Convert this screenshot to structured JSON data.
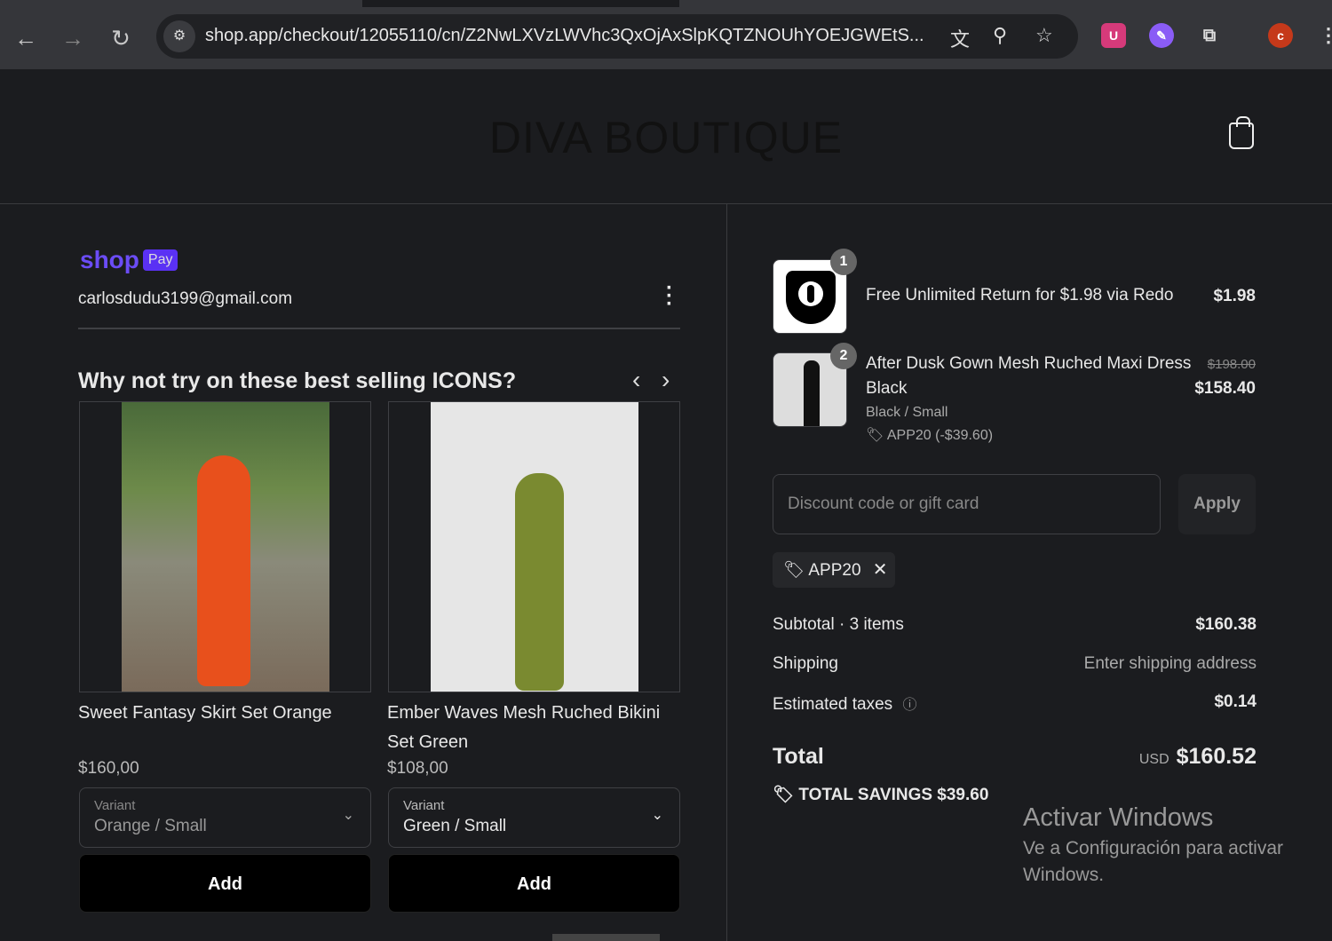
{
  "browser": {
    "url": "shop.app/checkout/12055110/cn/Z2NwLXVzLWVhc3QxOjAxSlpKQTZNOUhYOEJGWEtS...",
    "profile_initial": "c",
    "ext_u": "U"
  },
  "store": {
    "name": "DIVA BOUTIQUE"
  },
  "shoppay": {
    "shop": "shop",
    "pay": "Pay",
    "email": "carlosdudu3199@gmail.com"
  },
  "upsell": {
    "title": "Why not try on these best selling ICONS?",
    "products": [
      {
        "name": "Sweet Fantasy Skirt Set Orange",
        "price": "$160,00",
        "variant_label": "Variant",
        "variant": "Orange / Small",
        "add": "Add"
      },
      {
        "name": "Ember Waves Mesh Ruched Bikini Set Green",
        "price": "$108,00",
        "variant_label": "Variant",
        "variant": "Green / Small",
        "add": "Add"
      }
    ]
  },
  "summary": {
    "items": [
      {
        "qty": "1",
        "name": "Free Unlimited Return for $1.98 via Redo",
        "price": "$1.98"
      },
      {
        "qty": "2",
        "name": "After Dusk Gown Mesh Ruched Maxi Dress Black",
        "orig_price": "$198.00",
        "price": "$158.40",
        "variant": "Black / Small",
        "discount": "APP20 (-$39.60)"
      }
    ],
    "discount_placeholder": "Discount code or gift card",
    "apply": "Apply",
    "applied_code": "APP20",
    "subtotal_label": "Subtotal · 3 items",
    "subtotal": "$160.38",
    "shipping_label": "Shipping",
    "shipping": "Enter shipping address",
    "taxes_label": "Estimated taxes",
    "taxes": "$0.14",
    "total_label": "Total",
    "currency": "USD",
    "total": "$160.52",
    "savings_label": "TOTAL SAVINGS",
    "savings": "$39.60"
  },
  "watermark": {
    "title": "Activar Windows",
    "line1": "Ve a Configuración para activar",
    "line2": "Windows."
  }
}
